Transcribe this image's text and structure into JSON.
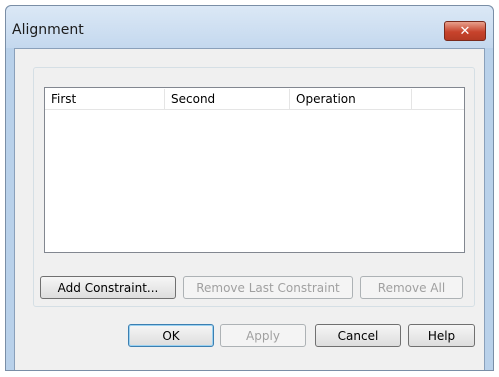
{
  "window": {
    "title": "Alignment",
    "close_glyph": "✕"
  },
  "constraints_list": {
    "columns": [
      "First",
      "Second",
      "Operation"
    ],
    "rows": []
  },
  "group_buttons": {
    "add": "Add Constraint...",
    "remove_last": "Remove Last Constraint",
    "remove_all": "Remove All"
  },
  "dialog_buttons": {
    "ok": "OK",
    "apply": "Apply",
    "cancel": "Cancel",
    "help": "Help"
  },
  "colors": {
    "accent": "#c7432c",
    "frame": "#b9d1ea",
    "client": "#f0f0f0"
  }
}
